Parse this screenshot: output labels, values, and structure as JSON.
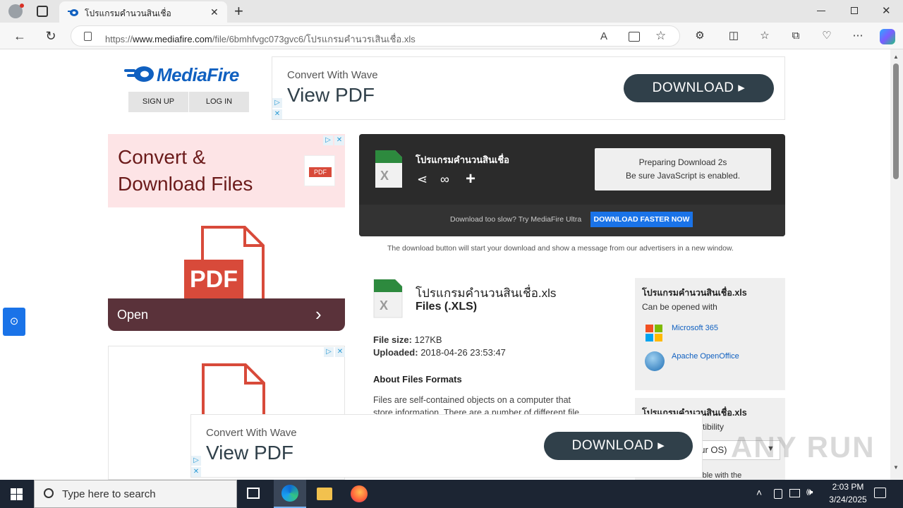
{
  "browser": {
    "tab_title": "โปรแกรมคำนวนสินเชื่อ",
    "url_prefix": "https://",
    "url_host": "www.mediafire.com",
    "url_path": "/file/6bmhfvgc073gvc6/โปรแกรมคำนวรเสินเชื่อ.xls",
    "read_aloud_label": "A"
  },
  "header": {
    "logo_text": "MediaFire",
    "signup": "SIGN UP",
    "login": "LOG IN"
  },
  "top_ad": {
    "subtitle": "Convert With Wave",
    "title": "View PDF",
    "button": "DOWNLOAD"
  },
  "side_ad": {
    "headline_line1": "Convert &",
    "headline_line2": "Download Files",
    "pdf_badge": "PDF",
    "big_pdf": "PDF",
    "open_label": "Open"
  },
  "download_box": {
    "filename": "โปรแกรมคำนวนสินเชื่อ",
    "preparing_line1": "Preparing Download 2s",
    "preparing_line2": "Be sure JavaScript is enabled.",
    "slow_text": "Download too slow? Try MediaFire Ultra",
    "faster_button": "DOWNLOAD FASTER NOW",
    "note": "The download button will start your download and show a message from our advertisers in a new window."
  },
  "file_info": {
    "name": "โปรแกรมคำนวนสินเชื่อ.xls",
    "type": "Files (.XLS)",
    "size_label": "File size:",
    "size_value": "127KB",
    "uploaded_label": "Uploaded:",
    "uploaded_value": "2018-04-26 23:53:47",
    "about_heading": "About Files Formats",
    "about_text_line1": "Files are self-contained objects on a computer that",
    "about_text_line2": "store information. There are a number of different file"
  },
  "open_with_panel": {
    "title": "โปรแกรมคำนวนสินเชื่อ.xls",
    "subtitle": "Can be opened with",
    "apps": [
      "Microsoft 365",
      "Apache OpenOffice"
    ]
  },
  "compat_panel": {
    "title": "โปรแกรมคำนวนสินเชื่อ.xls",
    "subtitle": "tibility",
    "select": "our OS)",
    "footer": "atible with the"
  },
  "bottom_ad": {
    "subtitle": "Convert With Wave",
    "title": "View PDF",
    "button": "DOWNLOAD"
  },
  "watermark": "ANY RUN",
  "taskbar": {
    "search_placeholder": "Type here to search",
    "time": "2:03 PM",
    "date": "3/24/2025"
  },
  "colors": {
    "accent_blue": "#1a73e8",
    "mediafire_blue": "#1060c0",
    "dark_box": "#2b2b2b",
    "ad_red": "#d84a3a"
  }
}
